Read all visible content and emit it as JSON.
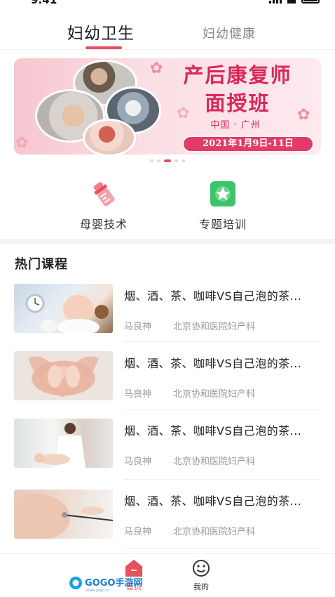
{
  "status_bar": {
    "time": "9:41"
  },
  "tabs": [
    {
      "label": "妇幼卫生",
      "active": true
    },
    {
      "label": "妇幼健康",
      "active": false
    }
  ],
  "banner": {
    "title_line1": "产后康复师",
    "title_line2": "面授班",
    "location": "中国 · 广州",
    "date": "2021年1月9日-11日",
    "slide_index": 3,
    "slide_count": 5
  },
  "categories": [
    {
      "label": "母婴技术",
      "icon": "baby-bottle-icon"
    },
    {
      "label": "专题培训",
      "icon": "star-badge-icon"
    }
  ],
  "hot_courses": {
    "title": "热门课程",
    "items": [
      {
        "title": "烟、酒、茶、咖啡VS自己泡的茶...",
        "author": "马良神",
        "hospital": "北京协和医院妇产科",
        "image": "baby-with-clock-photo"
      },
      {
        "title": "烟、酒、茶、咖啡VS自己泡的茶...",
        "author": "马良神",
        "hospital": "北京协和医院妇产科",
        "image": "baby-feet-heart-photo"
      },
      {
        "title": "烟、酒、茶、咖啡VS自己泡的茶...",
        "author": "马良神",
        "hospital": "北京协和医院妇产科",
        "image": "doctor-with-baby-photo"
      },
      {
        "title": "烟、酒、茶、咖啡VS自己泡的茶...",
        "author": "马良神",
        "hospital": "北京协和医院妇产科",
        "image": "pregnant-belly-stethoscope-photo"
      }
    ]
  },
  "bottom_nav": {
    "items": [
      {
        "label": "首页",
        "icon": "home-icon",
        "active": true
      },
      {
        "label": "我的",
        "icon": "smiley-face-icon",
        "active": false
      }
    ]
  },
  "watermark": {
    "text": "GOGO手游网",
    "sub": "www.gogo.cn"
  },
  "colors": {
    "accent": "#e8505b",
    "banner_text": "#d9285a",
    "green_icon": "#3cc46a",
    "pink_icon": "#f07f8a"
  }
}
